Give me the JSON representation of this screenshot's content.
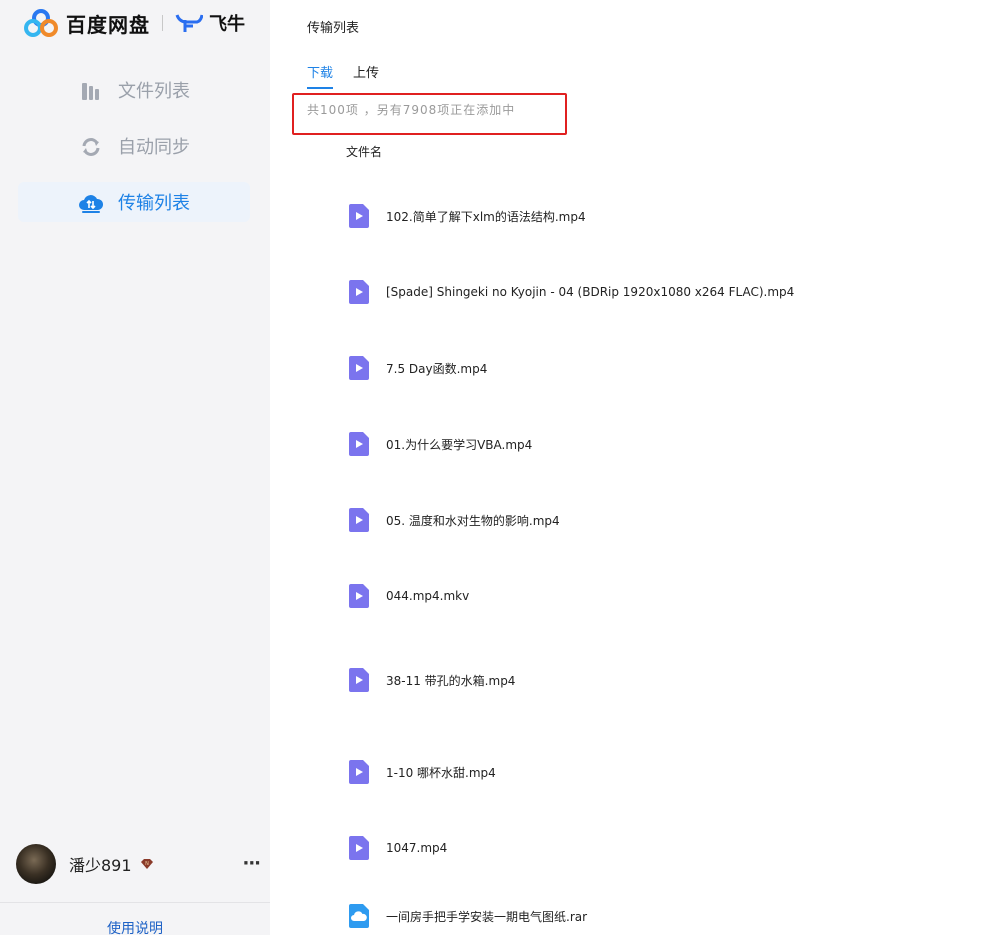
{
  "app": {
    "brand": "百度网盘",
    "partner": "飞牛"
  },
  "sidebar": {
    "items": [
      {
        "label": "文件列表",
        "icon": "file-list-icon",
        "active": false
      },
      {
        "label": "自动同步",
        "icon": "sync-icon",
        "active": false
      },
      {
        "label": "传输列表",
        "icon": "cloud-transfer-icon",
        "active": true
      }
    ],
    "user": {
      "name": "潘少891",
      "badge": "vip-badge-icon"
    },
    "help_label": "使用说明"
  },
  "main": {
    "title": "传输列表",
    "tabs": [
      {
        "label": "下载",
        "active": true
      },
      {
        "label": "上传",
        "active": false
      }
    ],
    "summary": "共100项 ，另有7908项正在添加中",
    "column_header": "文件名",
    "files": [
      {
        "name": "102.简单了解下xlm的语法结构.mp4",
        "type": "video"
      },
      {
        "name": "[Spade] Shingeki no Kyojin - 04 (BDRip 1920x1080 x264 FLAC).mp4",
        "type": "video"
      },
      {
        "name": "7.5 Day函数.mp4",
        "type": "video"
      },
      {
        "name": "01.为什么要学习VBA.mp4",
        "type": "video"
      },
      {
        "name": "05. 温度和水对生物的影响.mp4",
        "type": "video"
      },
      {
        "name": "044.mp4.mkv",
        "type": "video"
      },
      {
        "name": "38-11 带孔的水箱.mp4",
        "type": "video"
      },
      {
        "name": "1-10 哪杯水甜.mp4",
        "type": "video"
      },
      {
        "name": "1047.mp4",
        "type": "video"
      },
      {
        "name": "一间房手把手学安装一期电气图纸.rar",
        "type": "archive"
      }
    ]
  },
  "colors": {
    "accent": "#1e82e6",
    "video_icon": "#7b74ee",
    "archive_icon": "#2e9bf0",
    "highlight_box": "#e02020"
  }
}
